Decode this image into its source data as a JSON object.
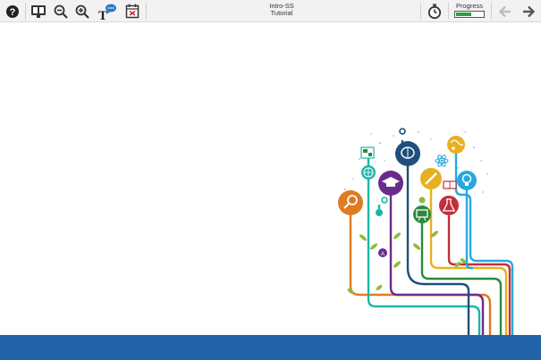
{
  "toolbar": {
    "icons": [
      "help-icon",
      "translate-icon",
      "zoom-out-icon",
      "zoom-in-icon",
      "text-comment-icon",
      "calendar-icon",
      "timer-icon",
      "back-arrow-icon",
      "forward-arrow-icon"
    ],
    "title_line1": "Intro-SS",
    "title_line2": "Tutorial",
    "progress_label": "Progress",
    "progress_value": 0.55
  },
  "colors": {
    "toolbar_bg": "#f2f2f2",
    "footer_bar": "#2263a8",
    "progress_fill": "#2e9e3e",
    "orange": "#e07b24",
    "teal": "#1ab7a8",
    "purple": "#6a2c8c",
    "navy": "#1f4f7a",
    "green": "#2a8a3e",
    "yellow": "#e8b021",
    "red": "#c0303a",
    "lightblue": "#29a8e0",
    "lime": "#8dbb3c"
  },
  "illustration": {
    "icons": [
      "magnifier-icon",
      "globe-icon",
      "graduation-cap-icon",
      "brain-icon",
      "chalkboard-icon",
      "pencil-icon",
      "flask-icon",
      "lightbulb-icon",
      "earth-icon",
      "atom-icon",
      "book-icon",
      "puzzle-icon",
      "leaf-icon",
      "circle-a-icon"
    ]
  }
}
